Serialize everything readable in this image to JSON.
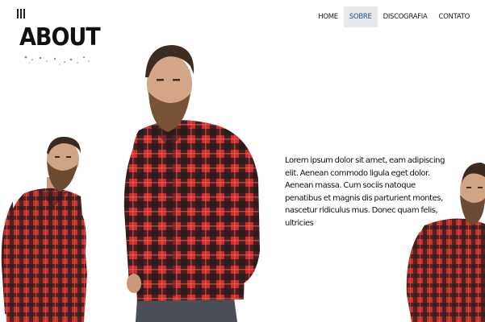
{
  "logo": {
    "text": "ABOUT"
  },
  "nav": {
    "items": [
      {
        "label": "HOME",
        "active": false
      },
      {
        "label": "SOBRE",
        "active": true
      },
      {
        "label": "DISCOGRAFIA",
        "active": false
      },
      {
        "label": "CONTATO",
        "active": false
      }
    ]
  },
  "about": {
    "text": "Lorem ipsum dolor sit amet, eam adipiscing elit. Aenean commodo ligula eget dolor. Aenean massa. Cum sociis natoque penatibus et magnis dis parturient montes, nascetur ridiculus mus. Donec quam felis, ultricies"
  },
  "colors": {
    "accent": "#1f4d8c",
    "nav_active_bg": "#e7e8ea",
    "shirt_red": "#c8302b",
    "shirt_dark": "#2a1d1f",
    "text": "#111111"
  }
}
